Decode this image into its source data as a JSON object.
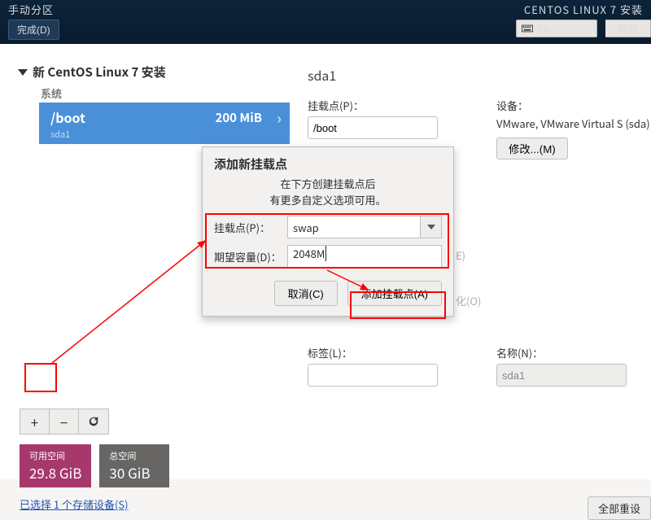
{
  "header": {
    "title_left": "手动分区",
    "title_right": "CENTOS LINUX 7 安装",
    "done": "完成(D)",
    "lang": "cn",
    "help": "帮助"
  },
  "tree": {
    "root": "新 CentOS Linux 7 安装",
    "section": "系统",
    "items": [
      {
        "mount": "/boot",
        "size": "200 MiB",
        "device": "sda1"
      }
    ]
  },
  "toolbar": {
    "add_glyph": "+",
    "remove_glyph": "−"
  },
  "space": {
    "avail_label": "可用空间",
    "avail_value": "29.8 GiB",
    "total_label": "总空间",
    "total_value": "30 GiB"
  },
  "footer": {
    "storage_link": "已选择 1 个存储设备(S)",
    "reset": "全部重设"
  },
  "right": {
    "heading": "sda1",
    "mount_label": "挂载点(P)：",
    "mount_value": "/boot",
    "device_label": "设备：",
    "device_text": "VMware, VMware Virtual S (sda)",
    "modify": "修改...(M)",
    "cap_suffix": "E)",
    "reformat_suffix": "化(O)",
    "label_label": "标签(L)：",
    "label_value": "",
    "name_label": "名称(N)：",
    "name_value": "sda1"
  },
  "dialog": {
    "title": "添加新挂载点",
    "msg_l1": "在下方创建挂载点后",
    "msg_l2": "有更多自定义选项可用。",
    "mount_label": "挂载点(P)：",
    "mount_value": "swap",
    "cap_label": "期望容量(D)：",
    "cap_value": "2048M",
    "cancel": "取消(C)",
    "add": "添加挂载点(A)"
  }
}
